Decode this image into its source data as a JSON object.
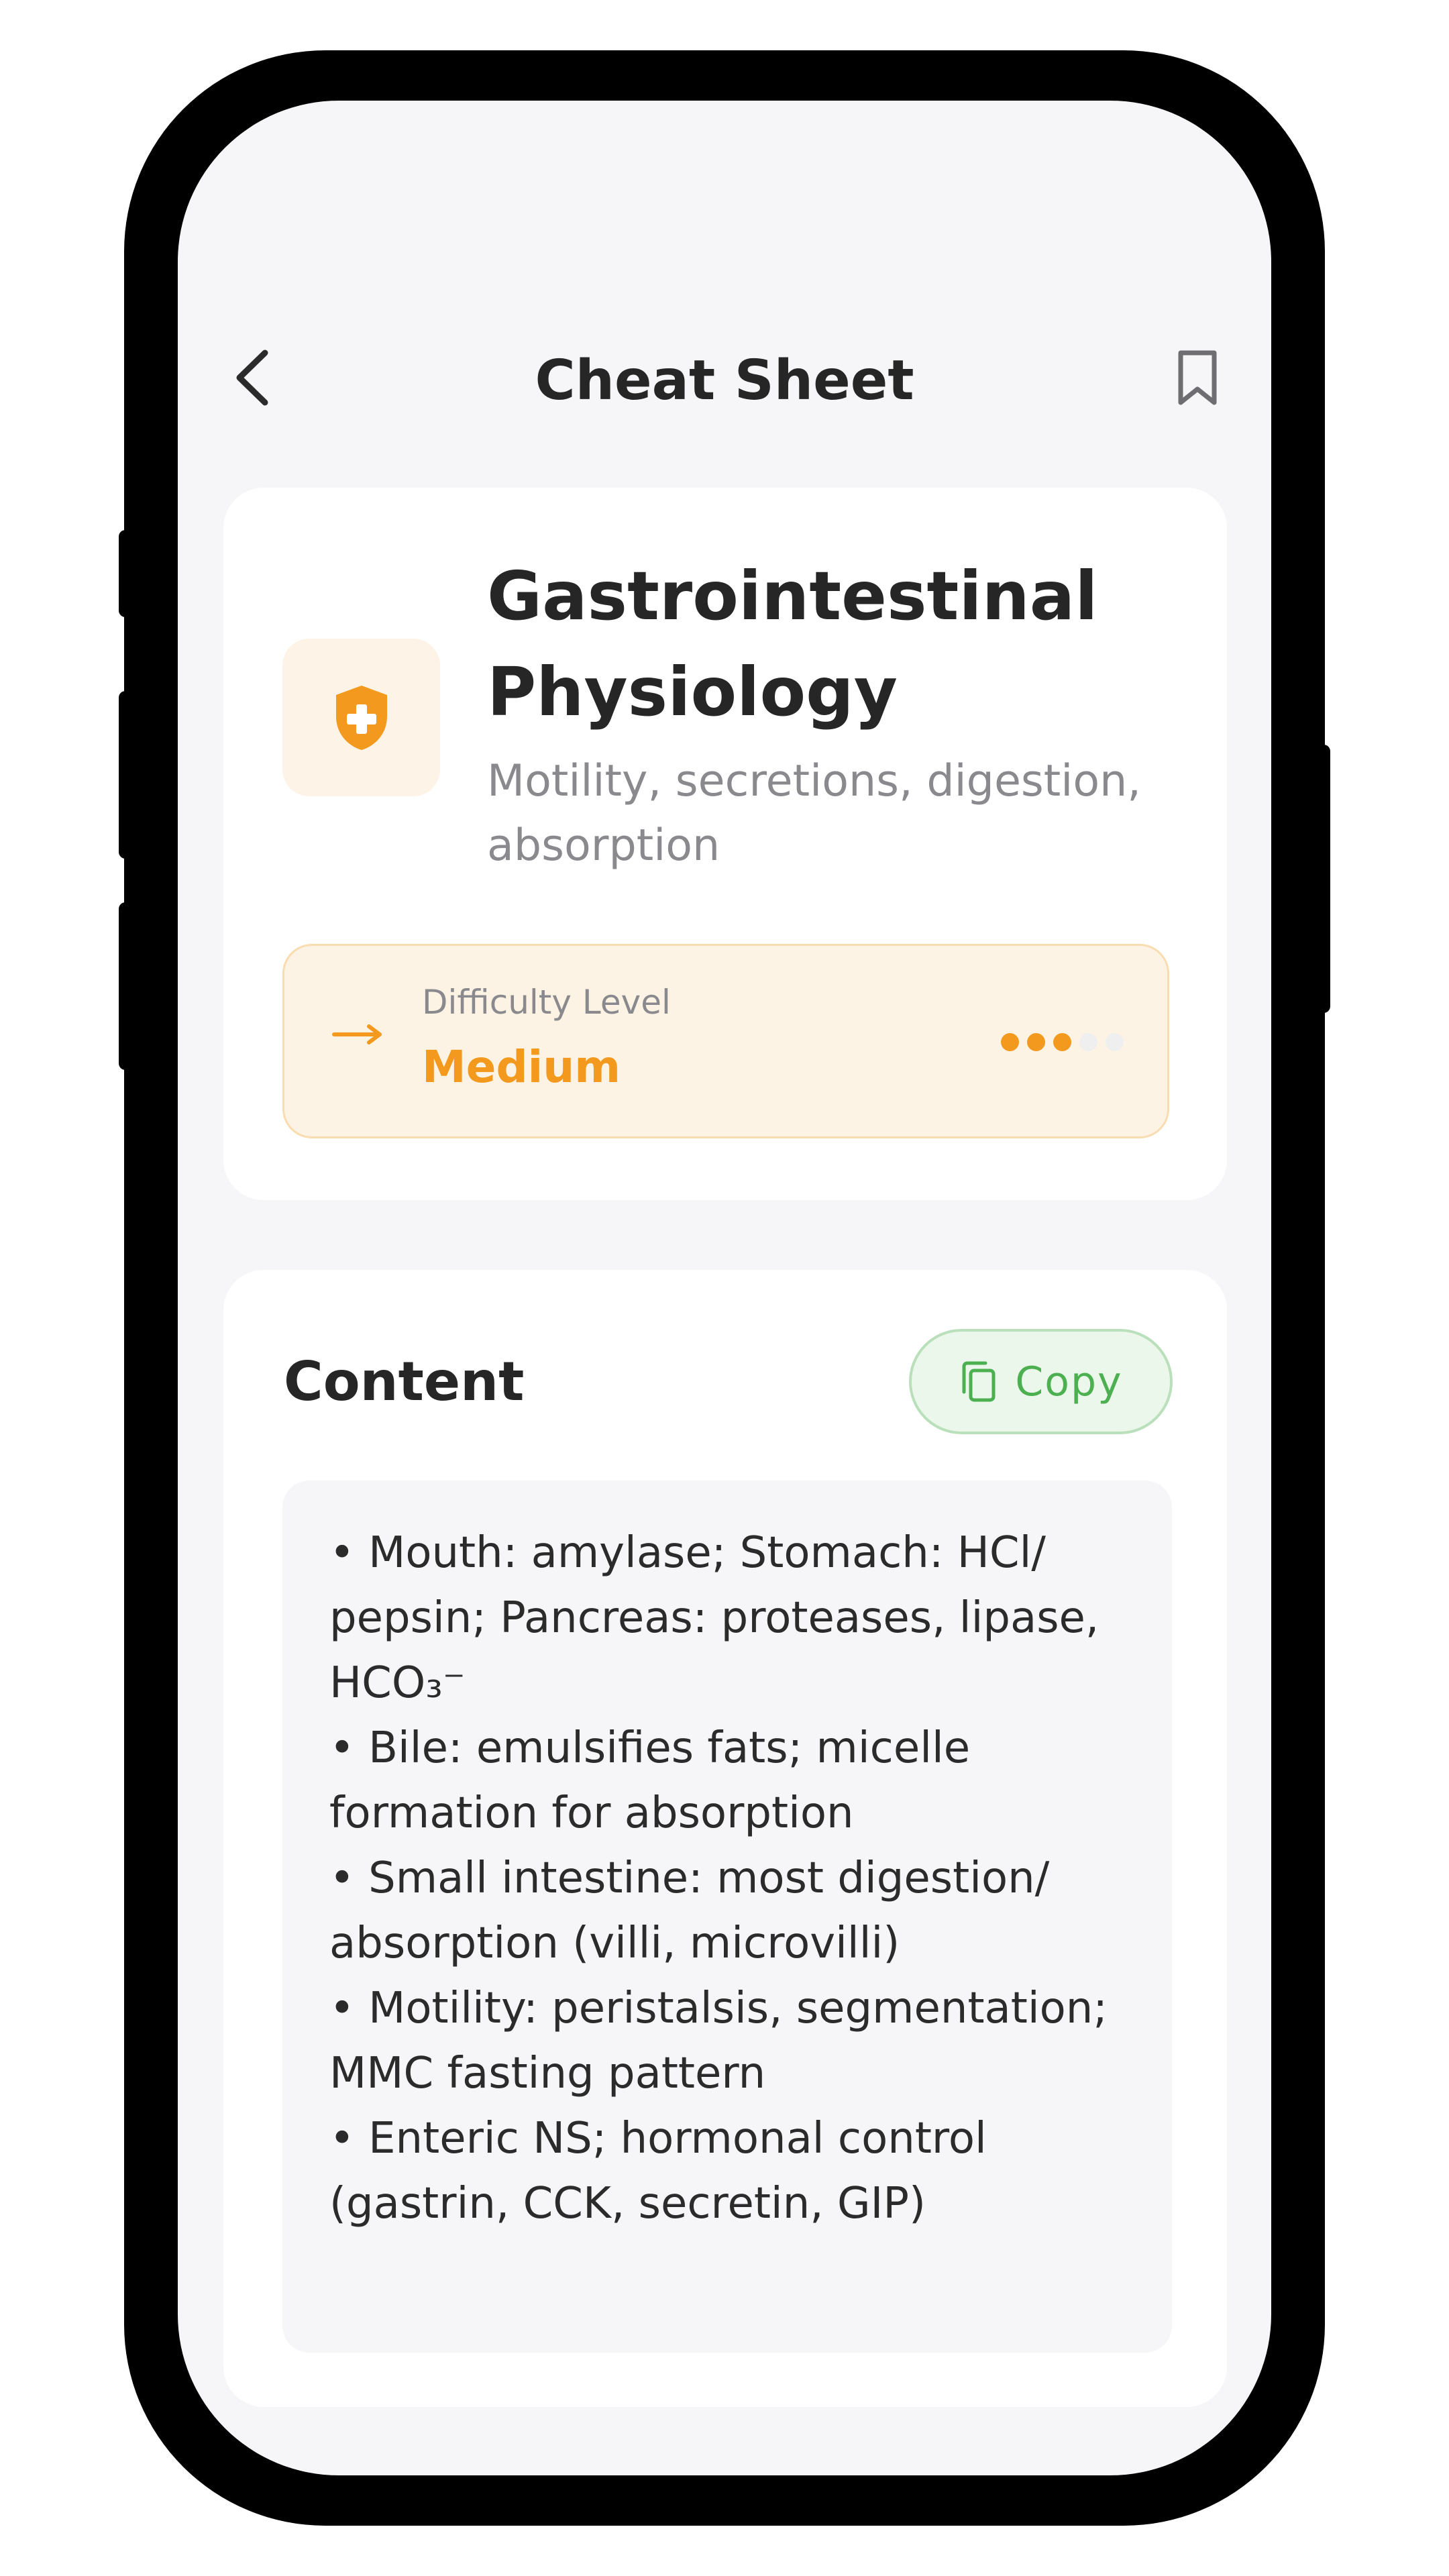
{
  "header": {
    "title": "Cheat Sheet",
    "back_icon": "chevron-left-icon",
    "bookmark_icon": "bookmark-icon"
  },
  "topic": {
    "title": "Gastrointestinal Physiology",
    "subtitle": "Motility, secretions, digestion, absorption",
    "icon": "shield-plus-icon"
  },
  "difficulty": {
    "label": "Difficulty Level",
    "value": "Medium",
    "level": 3,
    "max_level": 5,
    "icon": "arrow-right-icon"
  },
  "content": {
    "heading": "Content",
    "copy_label": "Copy",
    "copy_icon": "copy-icon",
    "text": "• Mouth: amylase; Stomach: HCl/ pepsin; Pancreas: proteases, lipase, HCO₃⁻\n• Bile: emulsifies fats; micelle formation for absorption\n• Small intestine: most digestion/ absorption (villi, microvilli)\n• Motility: peristalsis, segmentation; MMC fasting pattern\n• Enteric NS; hormonal control (gastrin, CCK, secretin, GIP)"
  },
  "colors": {
    "accent_orange": "#f39a1e",
    "accent_green": "#4caf50",
    "background": "#f6f6f8"
  }
}
